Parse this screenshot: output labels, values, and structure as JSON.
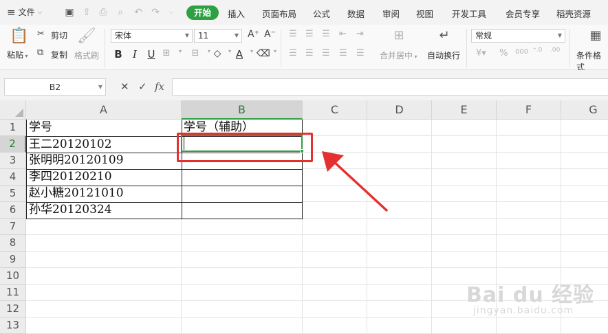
{
  "menubar": {
    "file_label": "文件",
    "tabs": [
      {
        "label": "开始",
        "active": true
      },
      {
        "label": "插入"
      },
      {
        "label": "页面布局"
      },
      {
        "label": "公式"
      },
      {
        "label": "数据"
      },
      {
        "label": "审阅"
      },
      {
        "label": "视图"
      },
      {
        "label": "开发工具"
      },
      {
        "label": "会员专享"
      },
      {
        "label": "稻壳资源"
      }
    ]
  },
  "ribbon": {
    "paste_label": "粘贴",
    "cut_label": "剪切",
    "copy_label": "复制",
    "format_painter_label": "格式刷",
    "font_name": "宋体",
    "font_size": "11",
    "merge_label": "合并居中",
    "wrap_label": "自动换行",
    "number_format": "常规",
    "cond_format_label": "条件格式"
  },
  "formula_bar": {
    "name_box": "B2",
    "fx_label": "fx",
    "value": ""
  },
  "sheet": {
    "columns": [
      "A",
      "B",
      "C",
      "D",
      "E",
      "F",
      "G"
    ],
    "rows": [
      "1",
      "2",
      "3",
      "4",
      "5",
      "6",
      "7",
      "8",
      "9",
      "10",
      "11",
      "12",
      "13"
    ],
    "cells": {
      "A1": "学号",
      "B1": "学号（辅助）",
      "A2": "王二20120102",
      "A3": "张明明20120109",
      "A4": "李四20120210",
      "A5": "赵小糖20121010",
      "A6": "孙华20120324"
    },
    "selected_cell": "B2"
  },
  "watermark": {
    "main": "Bai du 经验",
    "sub": "jingyan.baidu.com"
  },
  "colors": {
    "accent": "#2ea043",
    "annotation": "#e53030"
  }
}
